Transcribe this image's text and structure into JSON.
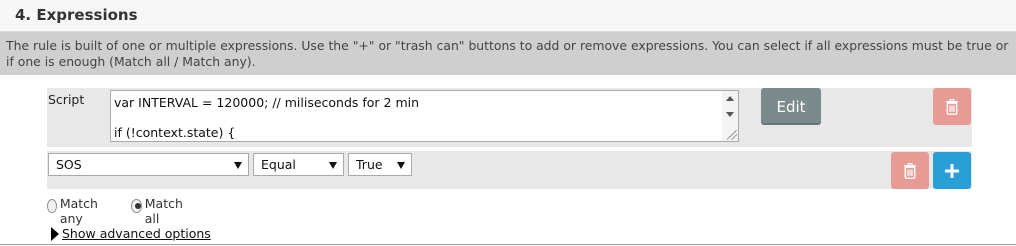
{
  "section": {
    "title": "4. Expressions",
    "description": "The rule is built of one or multiple expressions. Use the \"+\" or \"trash can\" buttons to add or remove expressions. You can select if all expressions must be true or if one is enough (Match all / Match any)."
  },
  "script_row": {
    "label": "Script",
    "lines": [
      "var INTERVAL = 120000; // miliseconds for 2 min",
      "if (!context.state) {"
    ],
    "edit_label": "Edit",
    "trash_icon": "trash-icon"
  },
  "condition_row": {
    "field": "SOS",
    "operator": "Equal",
    "value": "True",
    "trash_icon": "trash-icon",
    "add_icon": "plus-icon"
  },
  "match": {
    "any_label": "Match any",
    "all_label": "Match all",
    "selected": "all"
  },
  "advanced": {
    "label": "Show advanced options"
  },
  "colors": {
    "header_bg": "#f7f7f7",
    "info_bg": "#cfcfcf",
    "row_bg": "#e8e8e8",
    "edit_button": "#7b8a8b",
    "danger": "#e89b95",
    "primary": "#2a9fd6"
  }
}
